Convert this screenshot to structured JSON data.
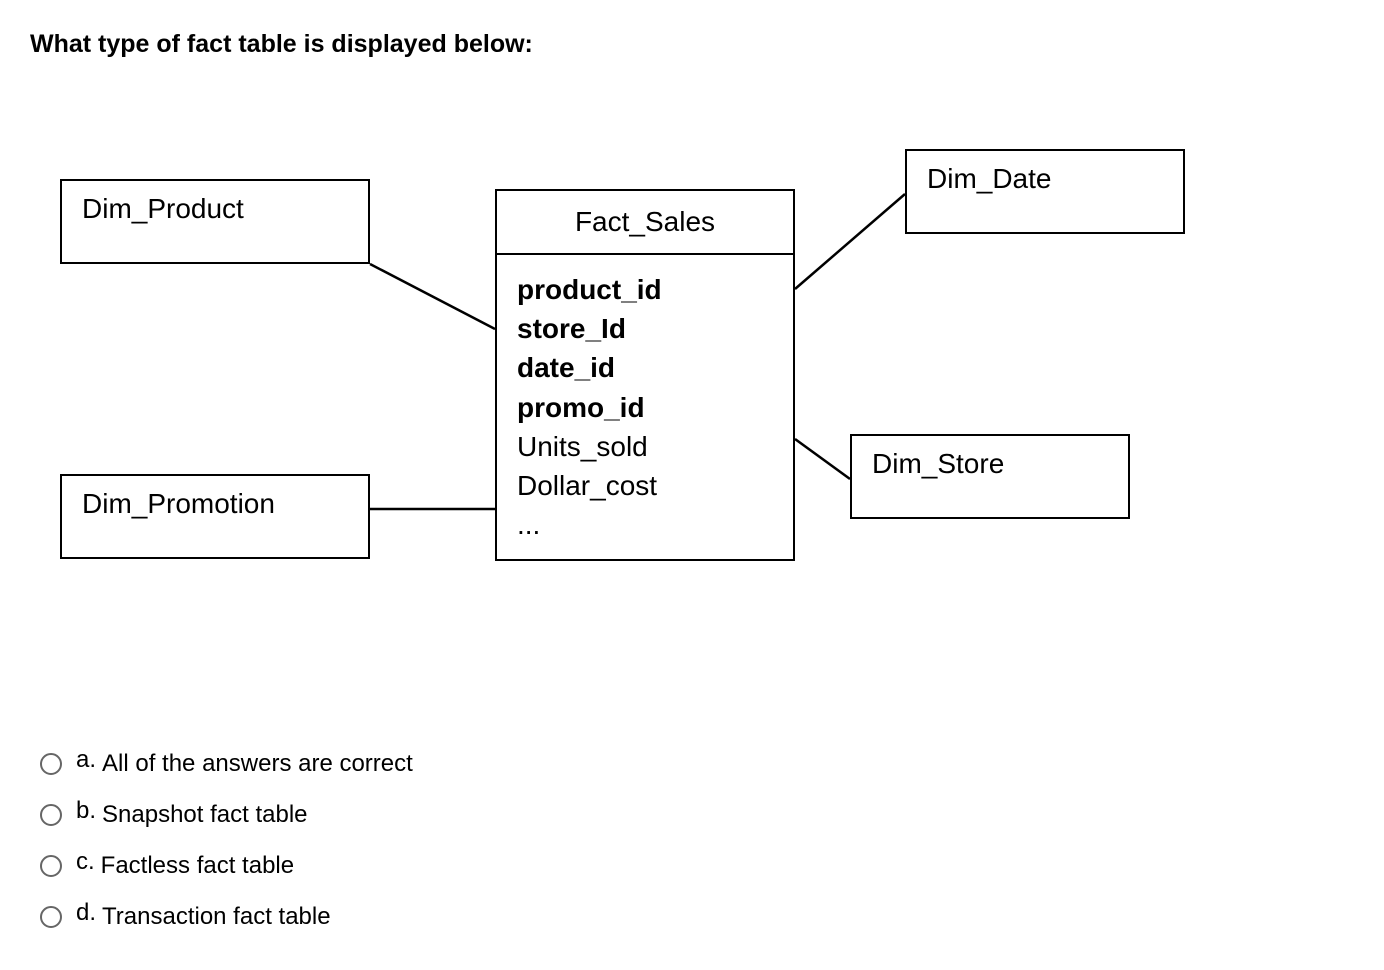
{
  "question": "What type of fact table is displayed below:",
  "diagram": {
    "dimProduct": "Dim_Product",
    "dimPromotion": "Dim_Promotion",
    "dimDate": "Dim_Date",
    "dimStore": "Dim_Store",
    "factTable": {
      "title": "Fact_Sales",
      "fields": [
        {
          "name": "product_id",
          "bold": true
        },
        {
          "name": "store_Id",
          "bold": true
        },
        {
          "name": "date_id",
          "bold": true
        },
        {
          "name": "promo_id",
          "bold": true
        },
        {
          "name": "Units_sold",
          "bold": false
        },
        {
          "name": "Dollar_cost",
          "bold": false
        },
        {
          "name": "...",
          "bold": false
        }
      ]
    }
  },
  "options": [
    {
      "letter": "a.",
      "text": "All of the answers are correct"
    },
    {
      "letter": "b.",
      "text": "Snapshot fact table"
    },
    {
      "letter": "c.",
      "text": "Factless fact table"
    },
    {
      "letter": "d.",
      "text": "Transaction fact table"
    }
  ]
}
